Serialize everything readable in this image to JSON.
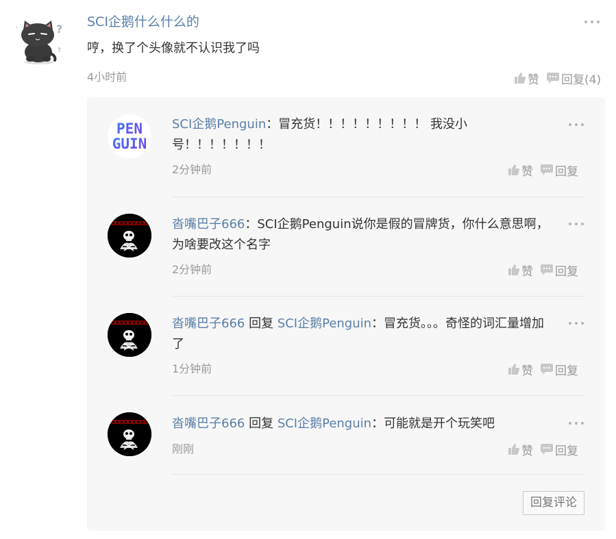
{
  "comment": {
    "author": "SCI企鹅什么什么的",
    "text": "哼，换了个头像就不认识我了吗",
    "time": "4小时前",
    "like_label": "赞",
    "reply_label": "回复(4)",
    "avatar_icon": "black-cat-avatar"
  },
  "replies": [
    {
      "author": "SCI企鹅Penguin",
      "reply_word": "",
      "target": "",
      "separator": "：",
      "text": "冒充货！！！！！！！！！ 我没小号！！！！！！！",
      "time": "2分钟前",
      "like_label": "赞",
      "reply_label": "回复",
      "avatar_icon": "penguin-logo-avatar",
      "avatar_text_1": "PEN",
      "avatar_text_2": "GUIN"
    },
    {
      "author": "沓嘴巴子666",
      "reply_word": "",
      "target": "",
      "separator": "：",
      "text": "SCI企鹅Penguin说你是假的冒牌货，你什么意思啊，为啥要改这个名字",
      "time": "2分钟前",
      "like_label": "赞",
      "reply_label": "回复",
      "avatar_icon": "skull-avatar"
    },
    {
      "author": "沓嘴巴子666",
      "reply_word": " 回复 ",
      "target": "SCI企鹅Penguin",
      "separator": "：",
      "text": "冒充货。。。奇怪的词汇量增加了",
      "time": "1分钟前",
      "like_label": "赞",
      "reply_label": "回复",
      "avatar_icon": "skull-avatar"
    },
    {
      "author": "沓嘴巴子666",
      "reply_word": " 回复 ",
      "target": "SCI企鹅Penguin",
      "separator": "：",
      "text": "可能就是开个玩笑吧",
      "time": "刚刚",
      "like_label": "赞",
      "reply_label": "回复",
      "avatar_icon": "skull-avatar"
    }
  ],
  "reply_comment_button": "回复评论",
  "colors": {
    "link": "#5a7ea8",
    "muted": "#999999",
    "panel_bg": "#f7f7f7"
  }
}
